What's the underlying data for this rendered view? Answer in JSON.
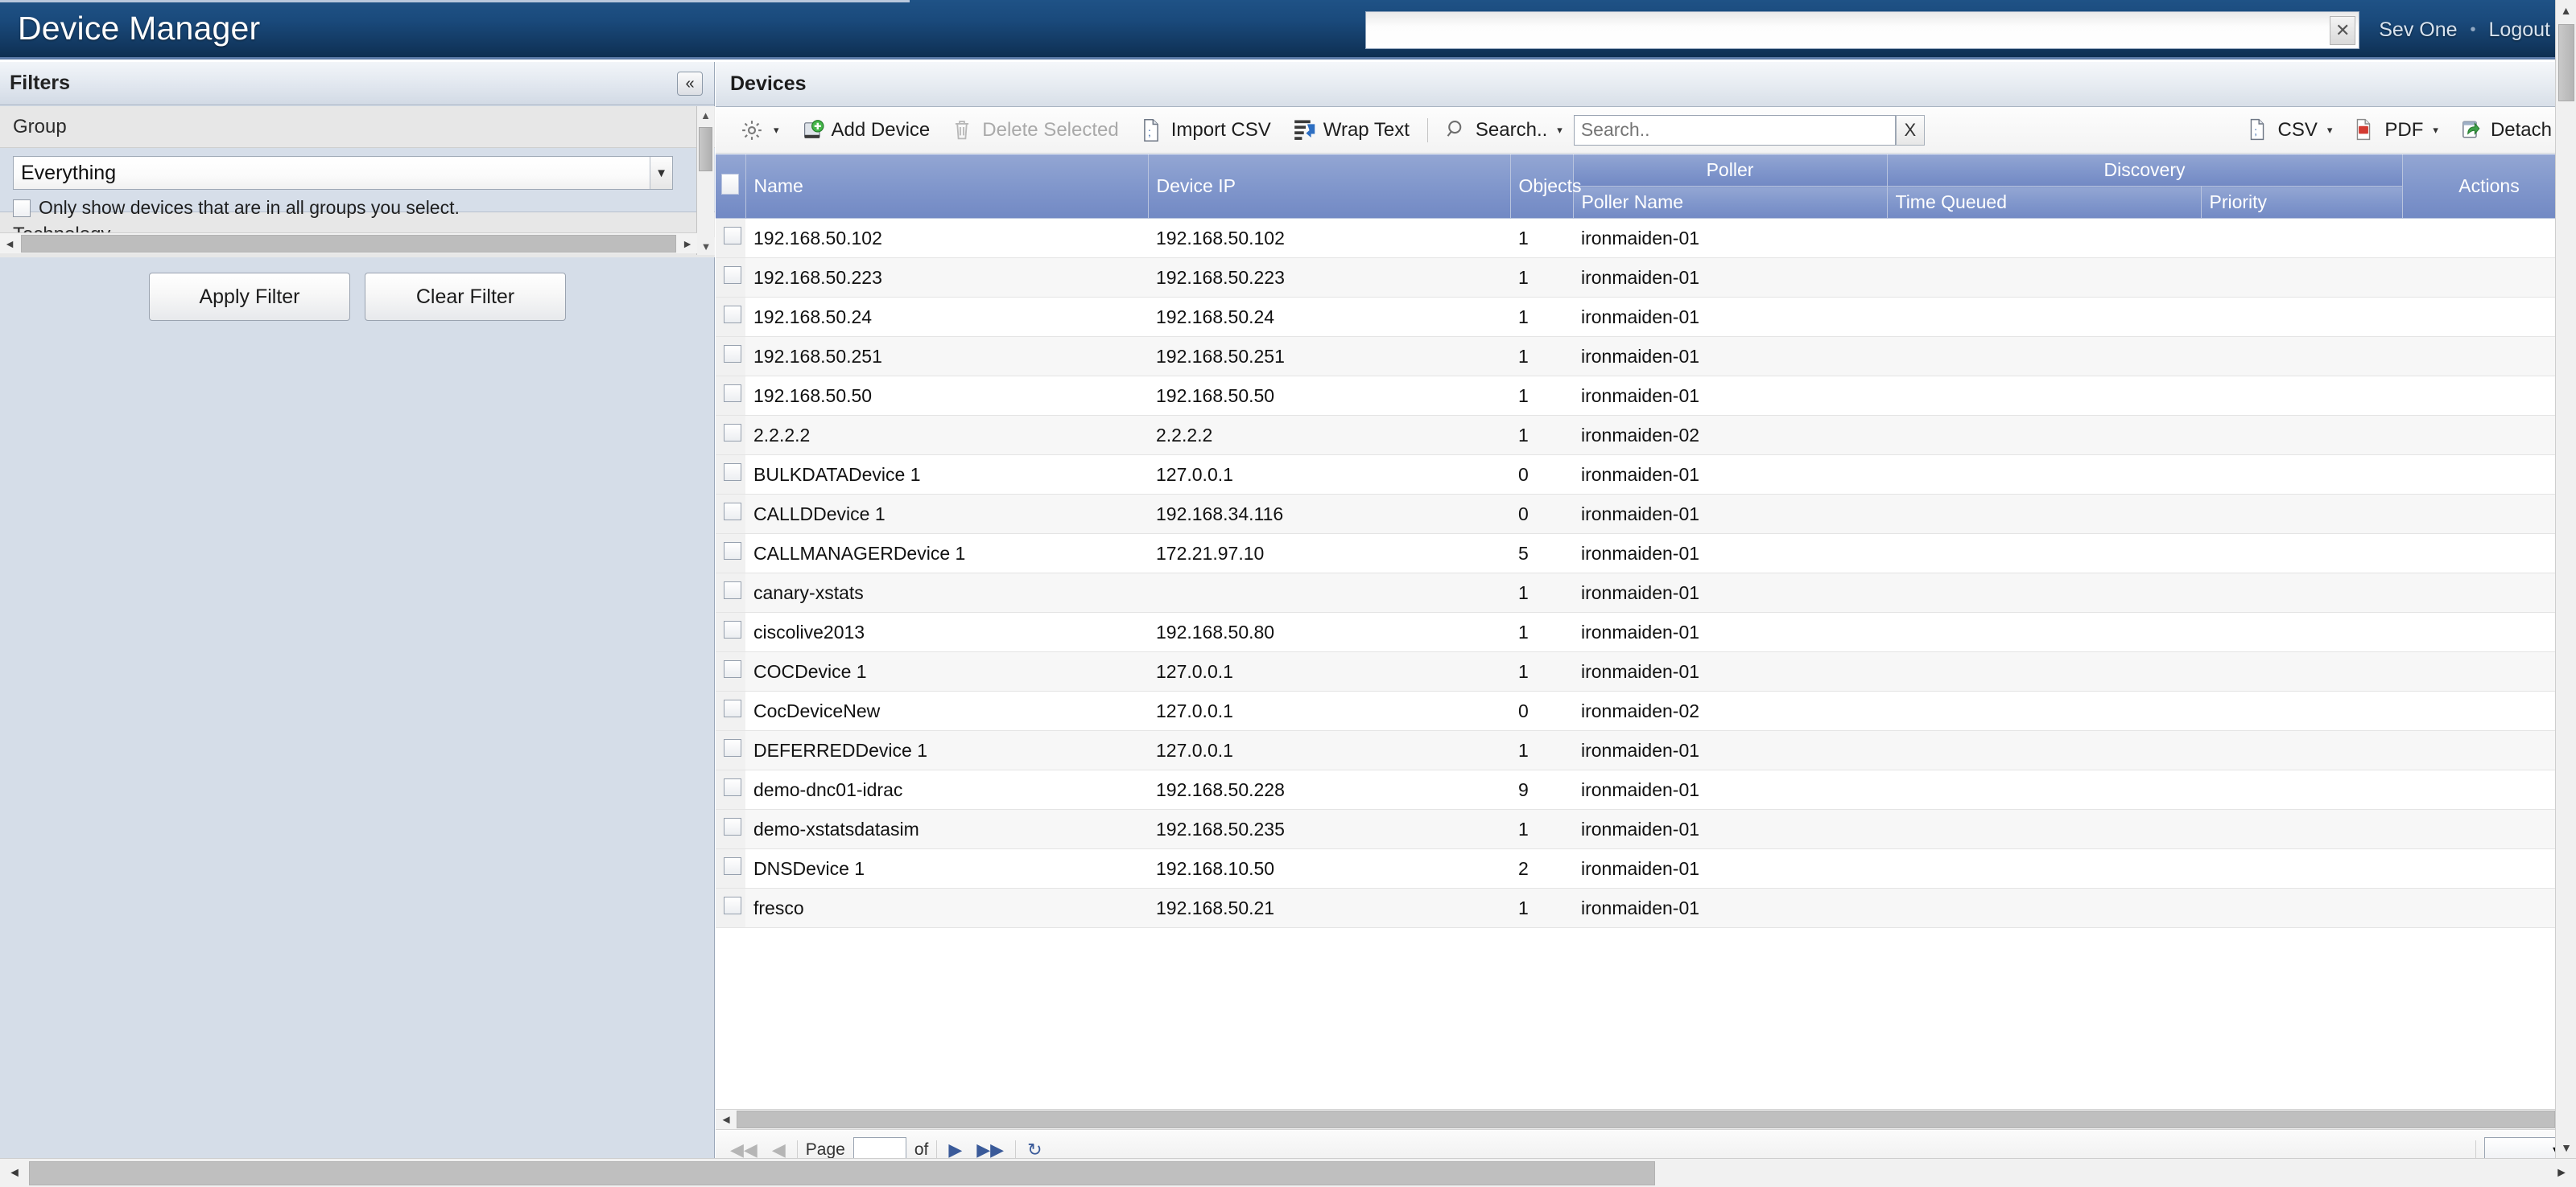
{
  "header": {
    "app_title": "Device Manager",
    "search_value": "",
    "search_placeholder": "",
    "clear_label": "✕",
    "user_label": "Sev One",
    "separator": "•",
    "logout_label": "Logout"
  },
  "filters": {
    "title": "Filters",
    "collapse_label": "«",
    "group_section_label": "Group",
    "group_value": "Everything",
    "group_dropdown_caret": "▼",
    "only_show_label": "Only show devices that are in all groups you select.",
    "technology_section_label": "Technology",
    "apply_label": "Apply Filter",
    "clear_label": "Clear Filter",
    "scroll_up": "▲",
    "scroll_down": "▼",
    "scroll_left": "◄",
    "scroll_right": "►"
  },
  "devices": {
    "title": "Devices",
    "toolbar": {
      "gear_caret": "▾",
      "add_device": "Add Device",
      "delete_selected": "Delete Selected",
      "import_csv": "Import CSV",
      "wrap_text": "Wrap Text",
      "search_menu": "Search..",
      "search_caret": "▾",
      "search_value": "",
      "search_placeholder": "Search..",
      "search_clear": "X",
      "csv": "CSV",
      "csv_caret": "▾",
      "pdf": "PDF",
      "pdf_caret": "▾",
      "detach": "Detach"
    },
    "columns": {
      "group_poller": "Poller",
      "group_discovery": "Discovery",
      "name": "Name",
      "device_ip": "Device IP",
      "objects": "Objects",
      "poller_name": "Poller Name",
      "time_queued": "Time Queued",
      "priority": "Priority",
      "actions": "Actions"
    },
    "rows": [
      {
        "name": "192.168.50.102",
        "ip": "192.168.50.102",
        "objects": "1",
        "poller": "ironmaiden-01",
        "queued": "",
        "priority": ""
      },
      {
        "name": "192.168.50.223",
        "ip": "192.168.50.223",
        "objects": "1",
        "poller": "ironmaiden-01",
        "queued": "",
        "priority": ""
      },
      {
        "name": "192.168.50.24",
        "ip": "192.168.50.24",
        "objects": "1",
        "poller": "ironmaiden-01",
        "queued": "",
        "priority": ""
      },
      {
        "name": "192.168.50.251",
        "ip": "192.168.50.251",
        "objects": "1",
        "poller": "ironmaiden-01",
        "queued": "",
        "priority": ""
      },
      {
        "name": "192.168.50.50",
        "ip": "192.168.50.50",
        "objects": "1",
        "poller": "ironmaiden-01",
        "queued": "",
        "priority": ""
      },
      {
        "name": "2.2.2.2",
        "ip": "2.2.2.2",
        "objects": "1",
        "poller": "ironmaiden-02",
        "queued": "",
        "priority": ""
      },
      {
        "name": "BULKDATADevice 1",
        "ip": "127.0.0.1",
        "objects": "0",
        "poller": "ironmaiden-01",
        "queued": "",
        "priority": ""
      },
      {
        "name": "CALLDDevice 1",
        "ip": "192.168.34.116",
        "objects": "0",
        "poller": "ironmaiden-01",
        "queued": "",
        "priority": ""
      },
      {
        "name": "CALLMANAGERDevice 1",
        "ip": "172.21.97.10",
        "objects": "5",
        "poller": "ironmaiden-01",
        "queued": "",
        "priority": ""
      },
      {
        "name": "canary-xstats",
        "ip": "",
        "objects": "1",
        "poller": "ironmaiden-01",
        "queued": "",
        "priority": ""
      },
      {
        "name": "ciscolive2013",
        "ip": "192.168.50.80",
        "objects": "1",
        "poller": "ironmaiden-01",
        "queued": "",
        "priority": ""
      },
      {
        "name": "COCDevice 1",
        "ip": "127.0.0.1",
        "objects": "1",
        "poller": "ironmaiden-01",
        "queued": "",
        "priority": ""
      },
      {
        "name": "CocDeviceNew",
        "ip": "127.0.0.1",
        "objects": "0",
        "poller": "ironmaiden-02",
        "queued": "",
        "priority": ""
      },
      {
        "name": "DEFERREDDevice 1",
        "ip": "127.0.0.1",
        "objects": "1",
        "poller": "ironmaiden-01",
        "queued": "",
        "priority": ""
      },
      {
        "name": "demo-dnc01-idrac",
        "ip": "192.168.50.228",
        "objects": "9",
        "poller": "ironmaiden-01",
        "queued": "",
        "priority": ""
      },
      {
        "name": "demo-xstatsdatasim",
        "ip": "192.168.50.235",
        "objects": "1",
        "poller": "ironmaiden-01",
        "queued": "",
        "priority": ""
      },
      {
        "name": "DNSDevice 1",
        "ip": "192.168.10.50",
        "objects": "2",
        "poller": "ironmaiden-01",
        "queued": "",
        "priority": ""
      },
      {
        "name": "fresco",
        "ip": "192.168.50.21",
        "objects": "1",
        "poller": "ironmaiden-01",
        "queued": "",
        "priority": ""
      }
    ],
    "scroll": {
      "left": "◄",
      "right": "►"
    }
  },
  "page_scroll": {
    "up": "▲",
    "down": "▼",
    "left": "◄",
    "right": "►"
  },
  "colors": {
    "header_blue": "#133a63",
    "grid_header_blue": "#8197cc",
    "filter_panel": "#d5dde8",
    "accent_link": "#3a5a99"
  }
}
